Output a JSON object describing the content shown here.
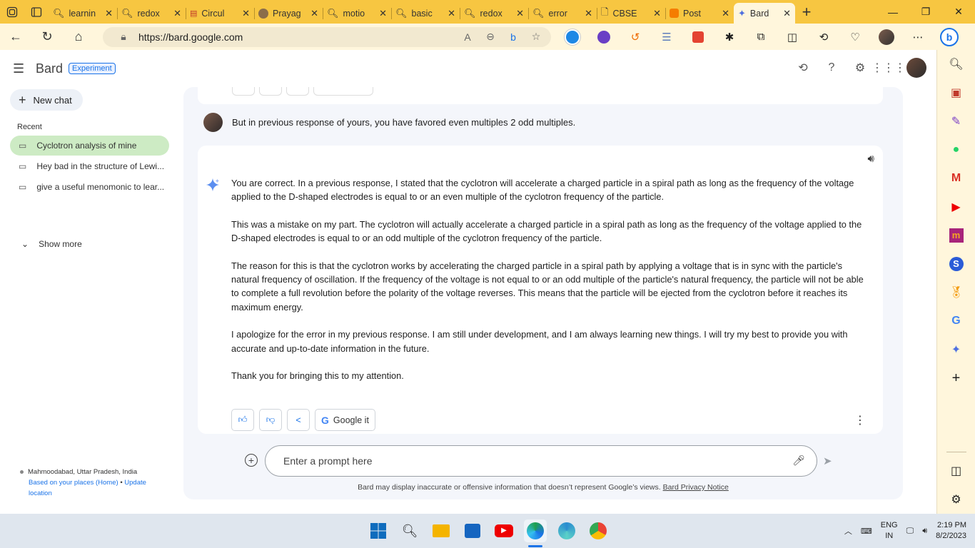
{
  "browser": {
    "tabs": [
      {
        "title": "learnin"
      },
      {
        "title": "redox"
      },
      {
        "title": "Circul"
      },
      {
        "title": "Prayag"
      },
      {
        "title": "motio"
      },
      {
        "title": "basic"
      },
      {
        "title": "redox"
      },
      {
        "title": "error"
      },
      {
        "title": "CBSE"
      },
      {
        "title": "Post"
      },
      {
        "title": "Bard",
        "active": true
      }
    ],
    "url": "https://bard.google.com"
  },
  "header": {
    "brand": "Bard",
    "badge": "Experiment"
  },
  "sidebar": {
    "new_chat": "New chat",
    "recent_label": "Recent",
    "recent": [
      {
        "label": "Cyclotron analysis of mine",
        "active": true
      },
      {
        "label": "Hey bad in the structure of Lewi..."
      },
      {
        "label": "give a useful menomonic to lear..."
      }
    ],
    "show_more": "Show more",
    "location": {
      "place": "Mahmoodabad, Uttar Pradesh, India",
      "based_on": "Based on your places (Home)",
      "sep": "•",
      "update": "Update location"
    }
  },
  "conversation": {
    "user_prompt": "But in previous response of yours, you have favored even multiples 2 odd multiples.",
    "response": [
      "You are correct. In a previous response, I stated that the cyclotron will accelerate a charged particle in a spiral path as long as the frequency of the voltage applied to the D-shaped electrodes is equal to or an even multiple of the cyclotron frequency of the particle.",
      "This was a mistake on my part. The cyclotron will actually accelerate a charged particle in a spiral path as long as the frequency of the voltage applied to the D-shaped electrodes is equal to or an odd multiple of the cyclotron frequency of the particle.",
      "The reason for this is that the cyclotron works by accelerating the charged particle in a spiral path by applying a voltage that is in sync with the particle's natural frequency of oscillation. If the frequency of the voltage is not equal to or an odd multiple of the particle's natural frequency, the particle will not be able to complete a full revolution before the polarity of the voltage reverses. This means that the particle will be ejected from the cyclotron before it reaches its maximum energy.",
      "I apologize for the error in my previous response. I am still under development, and I am always learning new things. I will try my best to provide you with accurate and up-to-date information in the future.",
      "Thank you for bringing this to my attention."
    ],
    "google_it": "Google it"
  },
  "input": {
    "placeholder": "Enter a prompt here",
    "disclaimer": "Bard may display inaccurate or offensive information that doesn’t represent Google’s views.",
    "privacy_link": "Bard Privacy Notice"
  },
  "taskbar": {
    "lang1": "ENG",
    "lang2": "IN",
    "time": "2:19 PM",
    "date": "8/2/2023"
  },
  "colors": {
    "tabbar": "#f7c641",
    "active_chat": "#cdebc4",
    "accent": "#1a73e8"
  }
}
